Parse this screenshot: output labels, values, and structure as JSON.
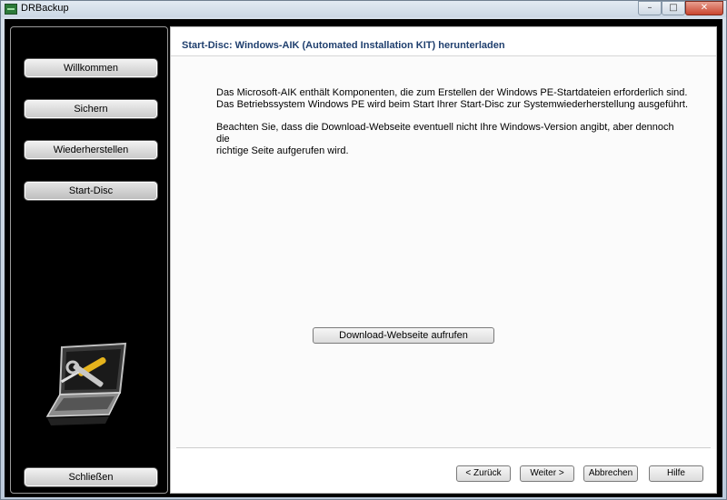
{
  "window": {
    "title": "DRBackup",
    "controls": {
      "minimize": "–",
      "maximize": "□",
      "close": "✕"
    }
  },
  "sidebar": {
    "items": [
      {
        "label": "Willkommen",
        "active": false
      },
      {
        "label": "Sichern",
        "active": false
      },
      {
        "label": "Wiederherstellen",
        "active": false
      },
      {
        "label": "Start-Disc",
        "active": true
      }
    ],
    "close_label": "Schließen",
    "illustration_icon": "laptop-tools-icon"
  },
  "main": {
    "title": "Start-Disc: Windows-AIK (Automated Installation KIT) herunterladen",
    "paragraph1_line1": "Das Microsoft-AIK enthält Komponenten, die zum Erstellen der Windows PE-Startdateien erforderlich sind.",
    "paragraph1_line2": "Das Betriebssystem Windows PE wird beim Start Ihrer Start-Disc zur Systemwiederherstellung ausgeführt.",
    "paragraph2_line1": "Beachten Sie, dass die Download-Webseite eventuell nicht Ihre Windows-Version angibt, aber dennoch die",
    "paragraph2_line2": "richtige Seite aufgerufen wird.",
    "download_button": "Download-Webseite aufrufen"
  },
  "footer": {
    "back": "< Zurück",
    "next": "Weiter >",
    "cancel": "Abbrechen",
    "help": "Hilfe"
  },
  "colors": {
    "header_title": "#1f3f6e",
    "sidebar_bg": "#000000"
  }
}
